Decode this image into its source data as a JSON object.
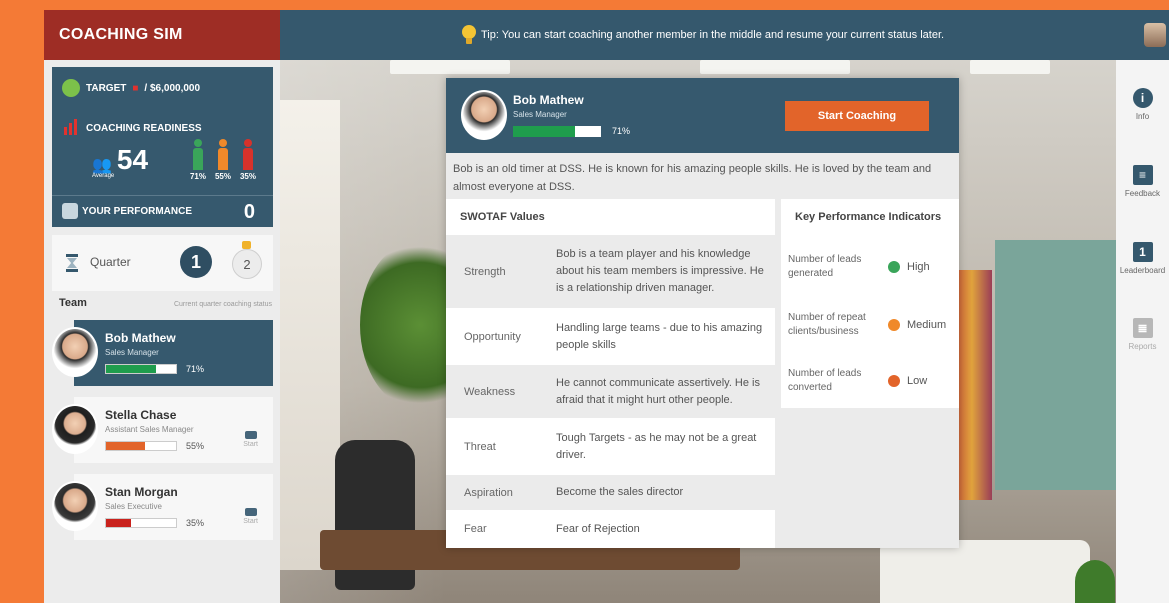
{
  "app": {
    "brand": "COACHING SIM"
  },
  "tip": {
    "text": "Tip: You can start coaching another member in the middle and resume your current status later."
  },
  "stats": {
    "target_label": "TARGET",
    "target_value": "/ $6,000,000",
    "readiness_label": "COACHING READINESS",
    "average_value": "54",
    "average_label": "Average",
    "figures": [
      {
        "pct": "71%",
        "color": "#3aa55a"
      },
      {
        "pct": "55%",
        "color": "#f0892a"
      },
      {
        "pct": "35%",
        "color": "#d7322b"
      }
    ],
    "performance_label": "YOUR PERFORMANCE",
    "performance_value": "0"
  },
  "quarter": {
    "label": "Quarter",
    "current": "1",
    "next": "2"
  },
  "team": {
    "label": "Team",
    "subtitle": "Current quarter coaching status",
    "members": [
      {
        "name": "Bob Mathew",
        "role": "Sales Manager",
        "pct": "71%",
        "progress": 0.71,
        "bar_color": "#1f9d4d",
        "start": ""
      },
      {
        "name": "Stella Chase",
        "role": "Assistant Sales Manager",
        "pct": "55%",
        "progress": 0.55,
        "bar_color": "#e2642a",
        "start": "Start"
      },
      {
        "name": "Stan Morgan",
        "role": "Sales Executive",
        "pct": "35%",
        "progress": 0.35,
        "bar_color": "#c9221d",
        "start": "Start"
      }
    ]
  },
  "rightbar": [
    {
      "label": "Info",
      "icon": "info-icon",
      "glyph": "i"
    },
    {
      "label": "Feedback",
      "icon": "feedback-icon",
      "glyph": "≡"
    },
    {
      "label": "Leaderboard",
      "icon": "leaderboard-icon",
      "glyph": "1"
    },
    {
      "label": "Reports",
      "icon": "report-icon",
      "glyph": "≣"
    }
  ],
  "card": {
    "name": "Bob Mathew",
    "role": "Sales Manager",
    "pct": "71%",
    "progress": 0.71,
    "start_button": "Start Coaching",
    "description": "Bob is an old timer at DSS. He is known for his amazing people skills. He is loved by the team and almost everyone at DSS.",
    "swotaf_header": "SWOTAF Values",
    "swotaf": [
      {
        "key": "Strength",
        "value": "Bob is a team player and his knowledge about his team members is impressive. He is a relationship driven manager."
      },
      {
        "key": "Opportunity",
        "value": "Handling large teams - due to his amazing people skills"
      },
      {
        "key": "Weakness",
        "value": "He cannot communicate assertively. He is afraid that it might hurt other people."
      },
      {
        "key": "Threat",
        "value": "Tough Targets - as he may not be a great driver."
      },
      {
        "key": "Aspiration",
        "value": "Become the sales director"
      },
      {
        "key": "Fear",
        "value": "Fear of Rejection"
      }
    ],
    "kpi_header": "Key Performance Indicators",
    "kpis": [
      {
        "label": "Number of leads generated",
        "value": "High",
        "color": "#3aa55a"
      },
      {
        "label": "Number of repeat clients/business",
        "value": "Medium",
        "color": "#f0892a"
      },
      {
        "label": "Number of leads converted",
        "value": "Low",
        "color": "#e2642a"
      }
    ]
  }
}
